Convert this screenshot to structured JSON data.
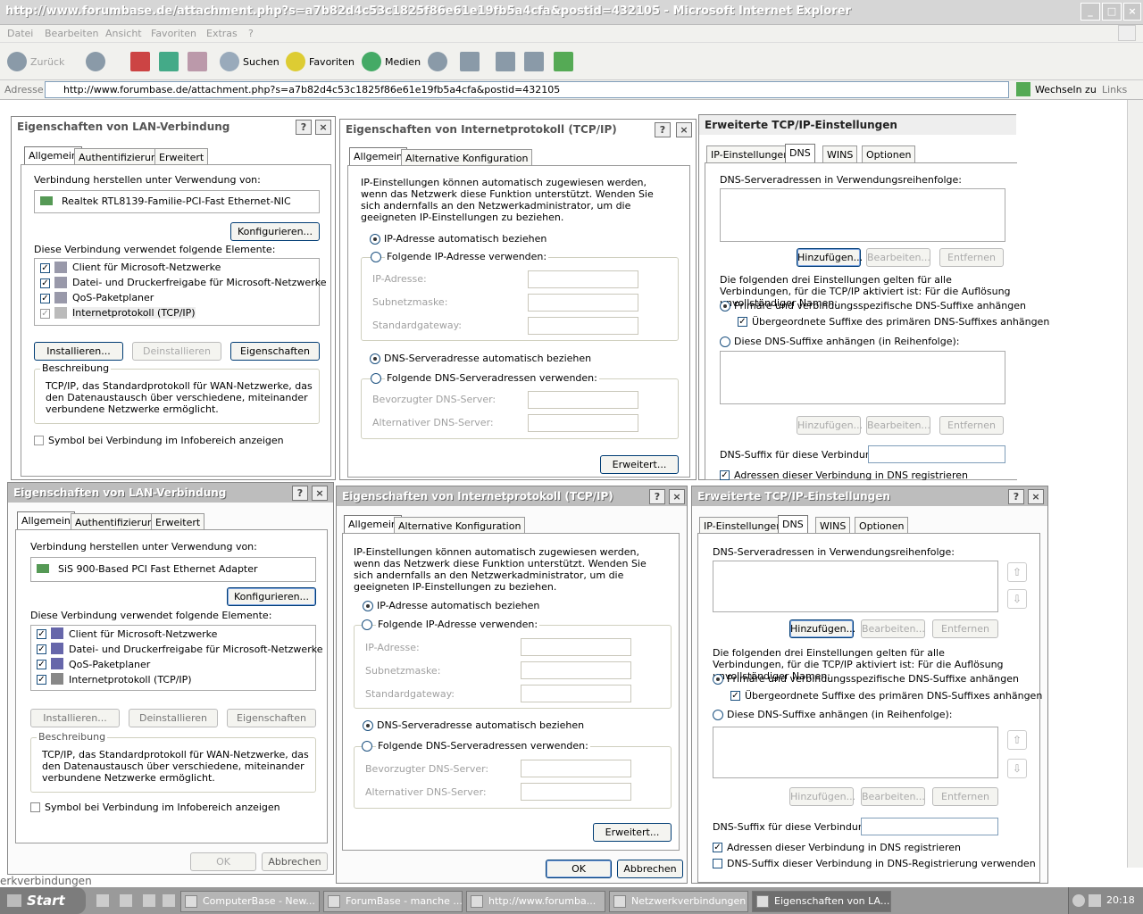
{
  "browser": {
    "title": "http://www.forumbase.de/attachment.php?s=a7b82d4c53c1825f86e61e19fb5a4cfa&postid=432105 - Microsoft Internet Explorer",
    "menu": [
      "Datei",
      "Bearbeiten",
      "Ansicht",
      "Favoriten",
      "Extras",
      "?"
    ],
    "toolbar": {
      "back": "Zurück",
      "search": "Suchen",
      "favorites": "Favoriten",
      "media": "Medien"
    },
    "address_label": "Adresse",
    "address": "http://www.forumbase.de/attachment.php?s=a7b82d4c53c1825f86e61e19fb5a4cfa&postid=432105",
    "go": "Wechseln zu",
    "links": "Links"
  },
  "lan_top": {
    "title": "Eigenschaften von LAN-Verbindung",
    "tabs": [
      "Allgemein",
      "Authentifizierung",
      "Erweitert"
    ],
    "connect_label": "Verbindung herstellen unter Verwendung von:",
    "adapter": "Realtek RTL8139-Familie-PCI-Fast Ethernet-NIC",
    "configure": "Konfigurieren...",
    "elements_label": "Diese Verbindung verwendet folgende Elemente:",
    "elements": [
      "Client für Microsoft-Netzwerke",
      "Datei- und Druckerfreigabe für Microsoft-Netzwerke",
      "QoS-Paketplaner",
      "Internetprotokoll (TCP/IP)"
    ],
    "install": "Installieren...",
    "uninstall": "Deinstallieren",
    "properties": "Eigenschaften",
    "desc_label": "Beschreibung",
    "desc": "TCP/IP, das Standardprotokoll für WAN-Netzwerke, das den Datenaustausch über verschiedene, miteinander verbundene Netzwerke ermöglicht.",
    "tray": "Symbol bei Verbindung im Infobereich anzeigen"
  },
  "lan_bottom": {
    "title": "Eigenschaften von LAN-Verbindung",
    "tabs": [
      "Allgemein",
      "Authentifizierung",
      "Erweitert"
    ],
    "connect_label": "Verbindung herstellen unter Verwendung von:",
    "adapter": "SiS 900-Based PCI Fast Ethernet Adapter",
    "configure": "Konfigurieren...",
    "elements_label": "Diese Verbindung verwendet folgende Elemente:",
    "elements": [
      "Client für Microsoft-Netzwerke",
      "Datei- und Druckerfreigabe für Microsoft-Netzwerke",
      "QoS-Paketplaner",
      "Internetprotokoll (TCP/IP)"
    ],
    "install": "Installieren...",
    "uninstall": "Deinstallieren",
    "properties": "Eigenschaften",
    "desc_label": "Beschreibung",
    "desc": "TCP/IP, das Standardprotokoll für WAN-Netzwerke, das den Datenaustausch über verschiedene, miteinander verbundene Netzwerke ermöglicht.",
    "tray": "Symbol bei Verbindung im Infobereich anzeigen",
    "ok": "OK",
    "cancel": "Abbrechen"
  },
  "tcp_top": {
    "title": "Eigenschaften von Internetprotokoll (TCP/IP)",
    "tabs": [
      "Allgemein",
      "Alternative Konfiguration"
    ],
    "intro": "IP-Einstellungen können automatisch zugewiesen werden, wenn das Netzwerk diese Funktion unterstützt. Wenden Sie sich andernfalls an den Netzwerkadministrator, um die geeigneten IP-Einstellungen zu beziehen.",
    "ip_auto": "IP-Adresse automatisch beziehen",
    "ip_manual": "Folgende IP-Adresse verwenden:",
    "ip_address": "IP-Adresse:",
    "subnet": "Subnetzmaske:",
    "gateway": "Standardgateway:",
    "dns_auto": "DNS-Serveradresse automatisch beziehen",
    "dns_manual": "Folgende DNS-Serveradressen verwenden:",
    "dns_pref": "Bevorzugter DNS-Server:",
    "dns_alt": "Alternativer DNS-Server:",
    "advanced": "Erweitert..."
  },
  "tcp_bottom": {
    "title": "Eigenschaften von Internetprotokoll (TCP/IP)",
    "tabs": [
      "Allgemein",
      "Alternative Konfiguration"
    ],
    "intro": "IP-Einstellungen können automatisch zugewiesen werden, wenn das Netzwerk diese Funktion unterstützt. Wenden Sie sich andernfalls an den Netzwerkadministrator, um die geeigneten IP-Einstellungen zu beziehen.",
    "ip_auto": "IP-Adresse automatisch beziehen",
    "ip_manual": "Folgende IP-Adresse verwenden:",
    "ip_address": "IP-Adresse:",
    "subnet": "Subnetzmaske:",
    "gateway": "Standardgateway:",
    "dns_auto": "DNS-Serveradresse automatisch beziehen",
    "dns_manual": "Folgende DNS-Serveradressen verwenden:",
    "dns_pref": "Bevorzugter DNS-Server:",
    "dns_alt": "Alternativer DNS-Server:",
    "advanced": "Erweitert...",
    "ok": "OK",
    "cancel": "Abbrechen"
  },
  "adv_top": {
    "title": "Erweiterte TCP/IP-Einstellungen",
    "tabs": [
      "IP-Einstellungen",
      "DNS",
      "WINS",
      "Optionen"
    ],
    "servers_label": "DNS-Serveradressen in Verwendungsreihenfolge:",
    "add": "Hinzufügen...",
    "edit": "Bearbeiten...",
    "remove": "Entfernen",
    "info": "Die folgenden drei Einstellungen gelten für alle Verbindungen, für die TCP/IP aktiviert ist: Für die Auflösung unvollständiger Namen:",
    "primary": "Primäre und verbindungsspezifische DNS-Suffixe anhängen",
    "parent": "Übergeordnete Suffixe des primären DNS-Suffixes anhängen",
    "these": "Diese DNS-Suffixe anhängen (in Reihenfolge):",
    "suffix_label": "DNS-Suffix für diese Verbindung:",
    "register": "Adressen dieser Verbindung in DNS registrieren"
  },
  "adv_bottom": {
    "title": "Erweiterte TCP/IP-Einstellungen",
    "tabs": [
      "IP-Einstellungen",
      "DNS",
      "WINS",
      "Optionen"
    ],
    "servers_label": "DNS-Serveradressen in Verwendungsreihenfolge:",
    "add": "Hinzufügen...",
    "edit": "Bearbeiten...",
    "remove": "Entfernen",
    "info": "Die folgenden drei Einstellungen gelten für alle Verbindungen, für die TCP/IP aktiviert ist: Für die Auflösung unvollständiger Namen:",
    "primary": "Primäre und verbindungsspezifische DNS-Suffixe anhängen",
    "parent": "Übergeordnete Suffixe des primären DNS-Suffixes anhängen",
    "these": "Diese DNS-Suffixe anhängen (in Reihenfolge):",
    "suffix_label": "DNS-Suffix für diese Verbindung:",
    "register": "Adressen dieser Verbindung in DNS registrieren",
    "use_suffix": "DNS-Suffix dieser Verbindung in DNS-Registrierung verwenden"
  },
  "taskbar": {
    "start": "Start",
    "tasks": [
      "ComputerBase - New...",
      "ForumBase - manche ...",
      "http://www.forumba...",
      "Netzwerkverbindungen",
      "Eigenschaften von LA..."
    ],
    "clock": "20:18",
    "behind_label": "erkverbindungen"
  }
}
